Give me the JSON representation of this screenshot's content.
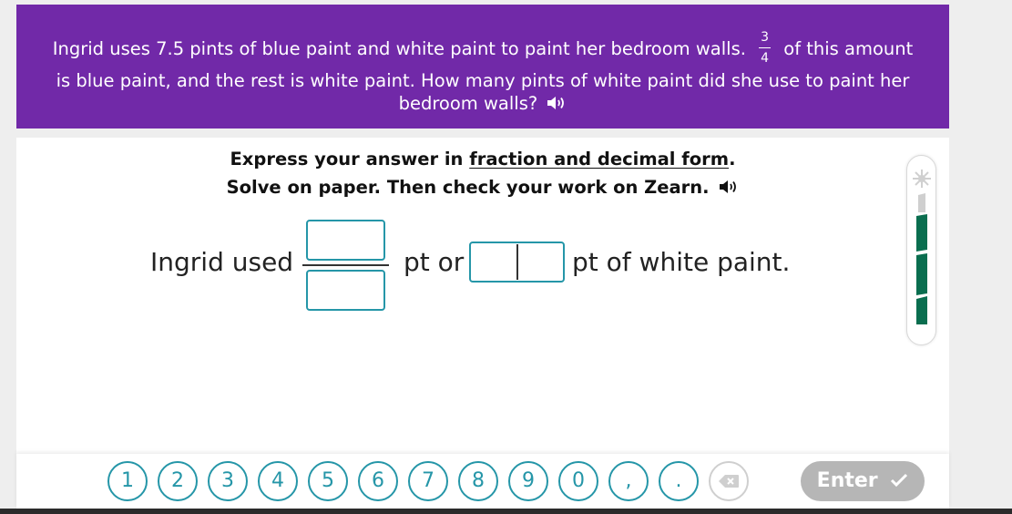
{
  "question": {
    "line1_before": "Ingrid uses 7.5 pints of blue paint and white paint to paint her bedroom walls.",
    "fraction_num": "3",
    "fraction_den": "4",
    "line1_after": "of this amount",
    "line2": "is blue paint, and the rest is white paint. How many pints of white paint did she use to paint her",
    "line3": "bedroom walls?"
  },
  "instructions": {
    "line1_prefix": "Express your answer in ",
    "line1_link": "fraction and decimal form",
    "line1_suffix": ".",
    "line2": "Solve on paper. Then check your work on Zearn."
  },
  "answer": {
    "prefix": "Ingrid used",
    "middle": "pt or",
    "suffix": "pt of white paint.",
    "numerator_value": "",
    "denominator_value": "",
    "decimal_whole_value": "",
    "decimal_fraction_value": ""
  },
  "progress": {
    "filled_segments": 3,
    "total_segments": 4
  },
  "keypad": {
    "keys": [
      "1",
      "2",
      "3",
      "4",
      "5",
      "6",
      "7",
      "8",
      "9",
      "0",
      ",",
      "."
    ],
    "backspace_icon": "backspace-icon",
    "enter_label": "Enter"
  },
  "colors": {
    "question_bg": "#7129a8",
    "accent": "#2596a8",
    "progress_fill": "#0a6e4f",
    "enter_disabled": "#b6b6b6"
  }
}
